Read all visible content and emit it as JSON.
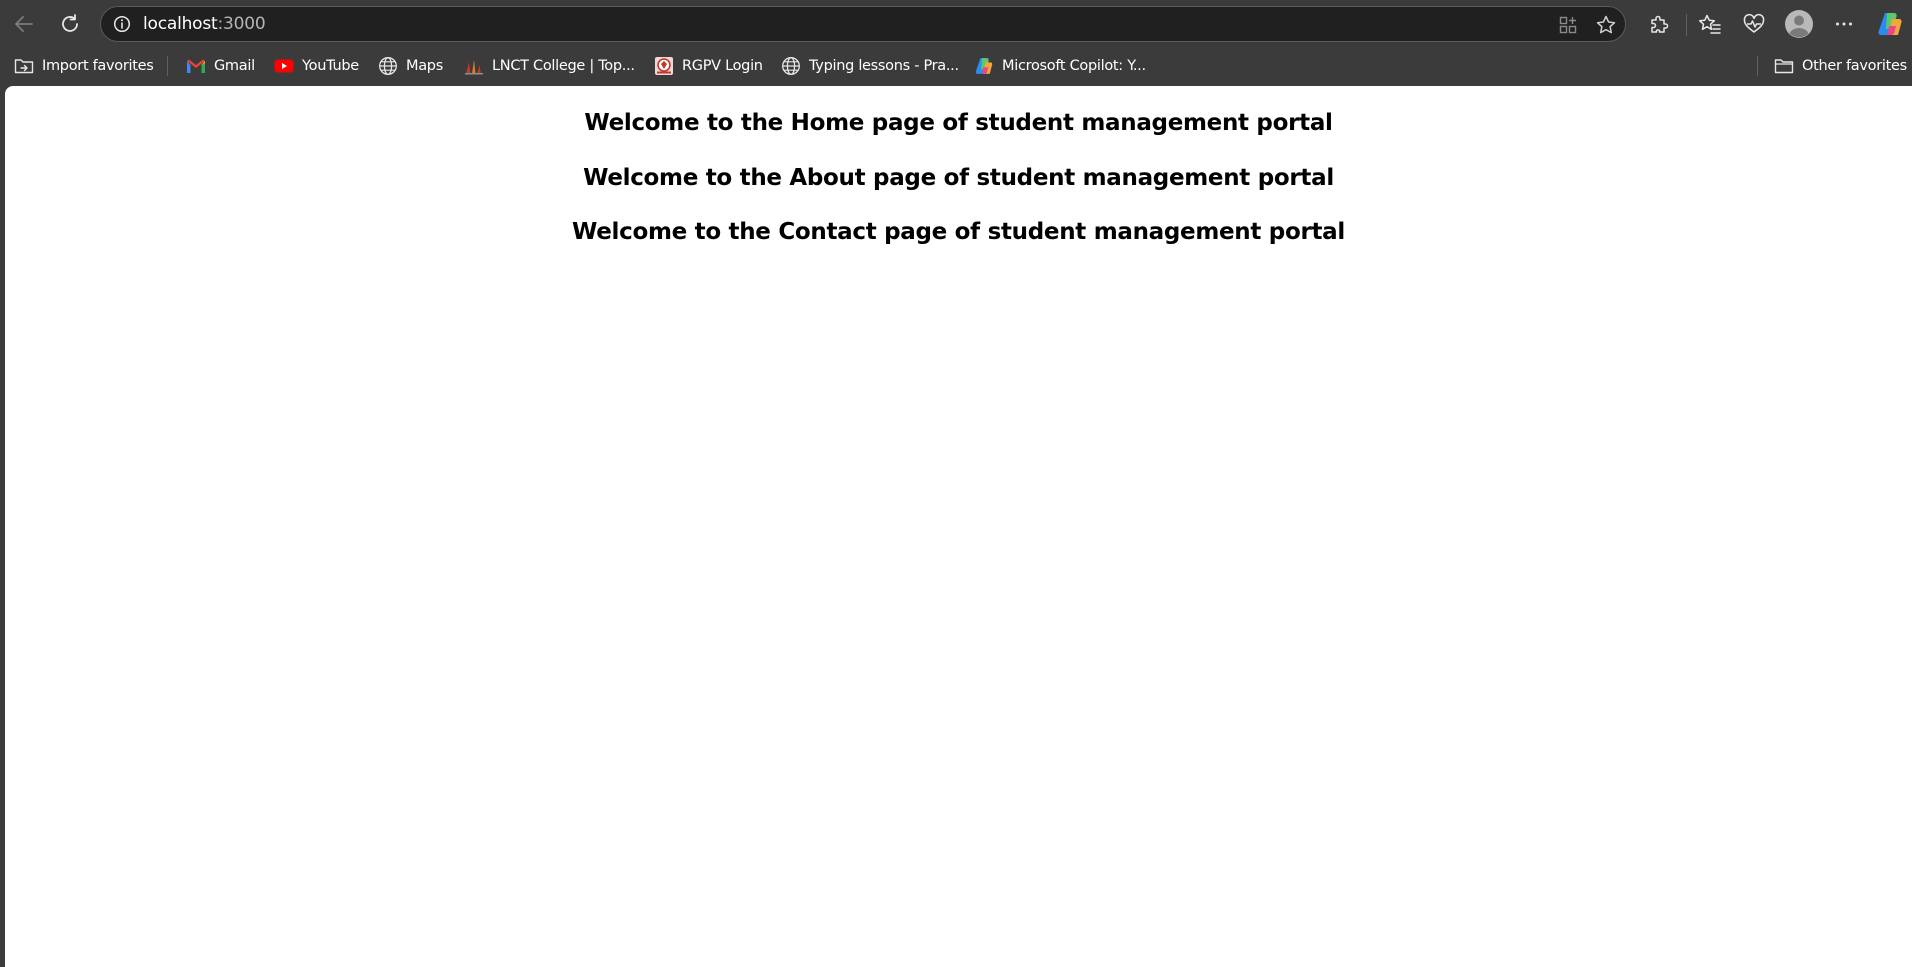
{
  "browser": {
    "address": {
      "host": "localhost",
      "port": ":3000"
    }
  },
  "bookmarks": {
    "import_favorites": "Import favorites",
    "items": [
      {
        "label": "Gmail"
      },
      {
        "label": "YouTube"
      },
      {
        "label": "Maps"
      },
      {
        "label": "LNCT College | Top..."
      },
      {
        "label": "RGPV Login"
      },
      {
        "label": "Typing lessons - Pra..."
      },
      {
        "label": "Microsoft Copilot: Y..."
      }
    ],
    "other_favorites": "Other favorites"
  },
  "page": {
    "headings": [
      "Welcome to the Home page of student management portal",
      "Welcome to the About page of student management portal",
      "Welcome to the Contact page of student management portal"
    ]
  }
}
